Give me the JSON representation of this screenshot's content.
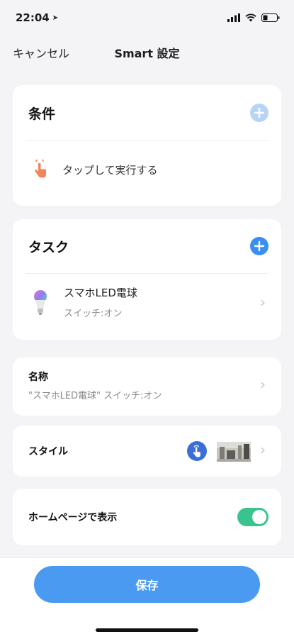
{
  "status_bar": {
    "time": "22:04"
  },
  "nav": {
    "cancel": "キャンセル",
    "title": "Smart 設定"
  },
  "condition": {
    "title": "条件",
    "item_label": "タップして実行する"
  },
  "task": {
    "title": "タスク",
    "device_name": "スマホLED電球",
    "device_state": "スイッチ:オン"
  },
  "name_row": {
    "label": "名称",
    "value": "\"スマホLED電球\" スイッチ:オン"
  },
  "style_row": {
    "label": "スタイル"
  },
  "homepage_row": {
    "label": "ホームページで表示",
    "enabled": true
  },
  "save_label": "保存",
  "colors": {
    "accent": "#4a9af2",
    "toggle_on": "#39c48d",
    "tap_icon": "#f0855a"
  }
}
